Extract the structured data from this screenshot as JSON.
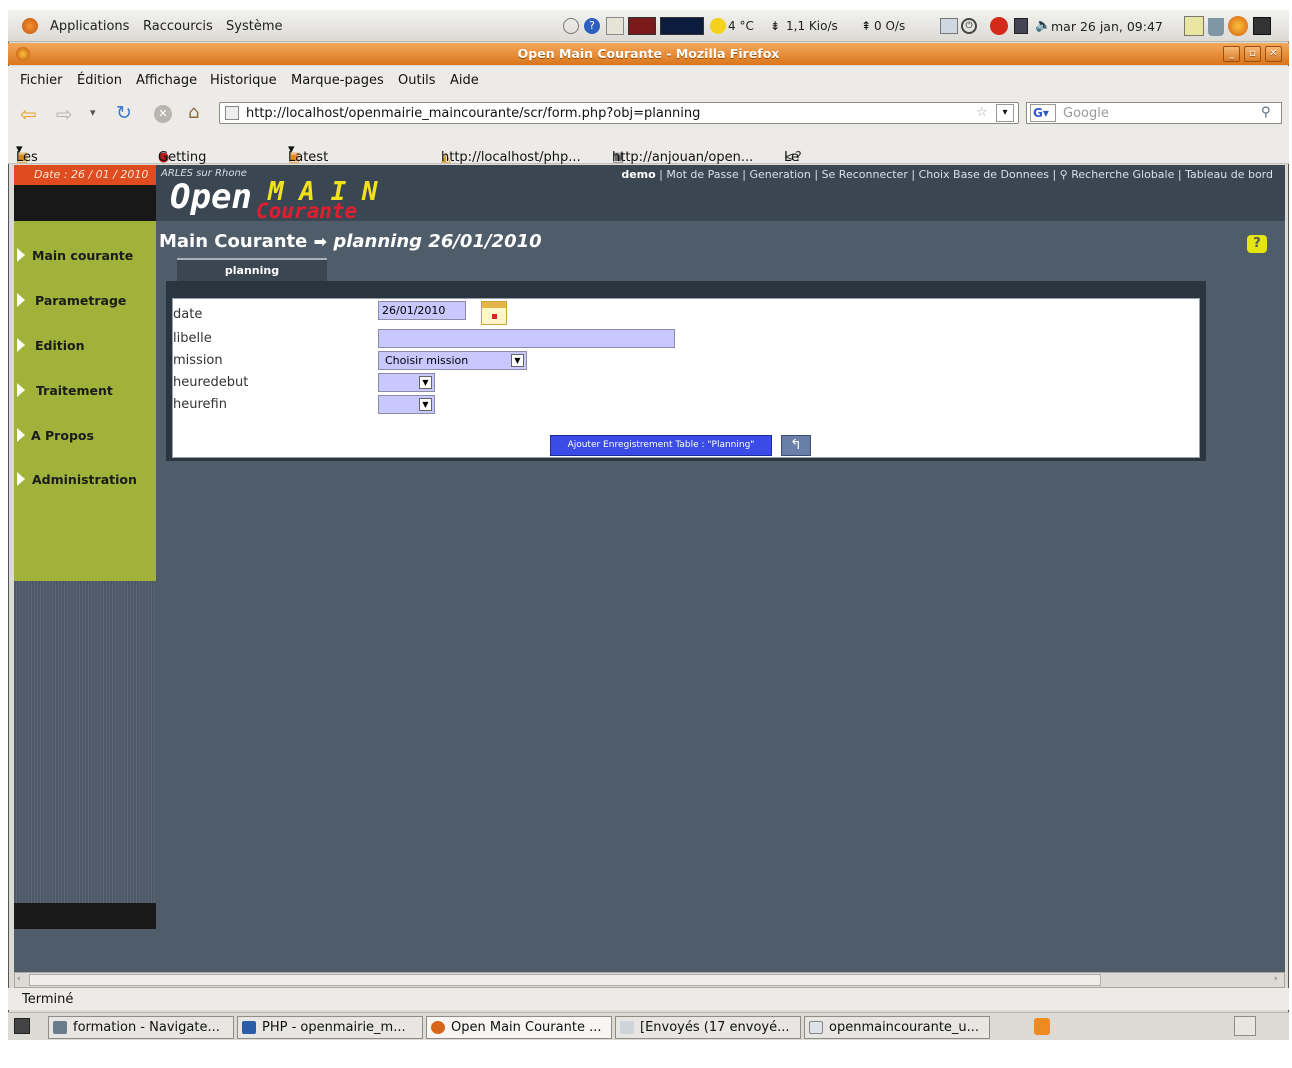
{
  "panel": {
    "menus": [
      "Applications",
      "Raccourcis",
      "Système"
    ],
    "weather": "4 °C",
    "net_down": "1,1 Kio/s",
    "net_up": "0 O/s",
    "clock": "mar 26 jan, 09:47"
  },
  "window": {
    "title": "Open Main Courante - Mozilla Firefox"
  },
  "menubar": [
    "Fichier",
    "Édition",
    "Affichage",
    "Historique",
    "Marque-pages",
    "Outils",
    "Aide"
  ],
  "navbar": {
    "url": "http://localhost/openmairie_maincourante/scr/form.php?obj=planning",
    "search_placeholder": "Google"
  },
  "bookmarks": [
    "Les plus visités",
    "Getting Started",
    "Latest Headlines",
    "http://localhost/php...",
    "http://anjouan/open...",
    "Le PHP Facile - Tout ..."
  ],
  "app": {
    "date_label": "Date : 26 / 01 / 2010",
    "city": "ARLES sur Rhone",
    "logo_open": "Open",
    "logo_main": "M A I N",
    "logo_courante": "Courante",
    "top_links": [
      "demo",
      "Mot de Passe",
      "Generation",
      "Se Reconnecter",
      "Choix Base de Donnees",
      "Recherche Globale",
      "Tableau de bord"
    ],
    "left_nav": [
      "Main courante",
      "Parametrage",
      "Edition",
      "Traitement",
      "A Propos",
      "Administration"
    ],
    "breadcrumb_root": "Main Courante",
    "breadcrumb_page": "planning 26/01/2010",
    "tab": "planning",
    "form": {
      "fields": [
        {
          "label": "date",
          "value": "26/01/2010"
        },
        {
          "label": "libelle",
          "value": ""
        },
        {
          "label": "mission",
          "value": "Choisir mission"
        },
        {
          "label": "heuredebut",
          "value": ""
        },
        {
          "label": "heurefin",
          "value": ""
        }
      ],
      "submit_label": "Ajouter Enregistrement Table : \"Planning\""
    }
  },
  "status": "Terminé",
  "taskbar": [
    "formation - Navigate...",
    "PHP - openmairie_m...",
    "Open Main Courante ...",
    "[Envoyés (17 envoyé...",
    "openmaincourante_u..."
  ],
  "colors": {
    "titlebar": "#e28a35",
    "page_bg": "#4f5c69",
    "nav_bg": "#a0b23a",
    "date_bg": "#e04c1f",
    "input_bg": "#c8c8ff",
    "submit_bg": "#3b4ce6"
  }
}
